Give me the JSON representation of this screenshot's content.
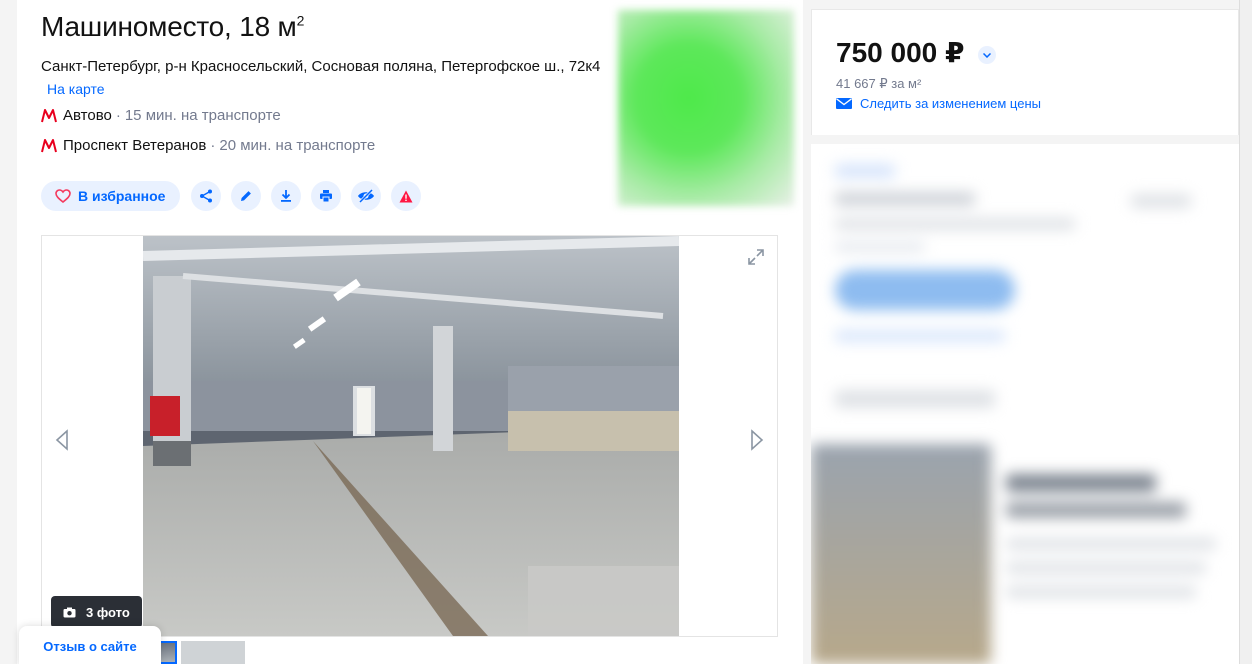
{
  "listing": {
    "title": "Машиноместо, 18 м",
    "title_sup": "2",
    "address_line": "Санкт-Петербург, р-н Красносельский, Сосновая поляна, Петергофское ш., 72к4",
    "map_link": "На карте",
    "metro": [
      {
        "station": "Автово",
        "time": "15 мин. на транспорте"
      },
      {
        "station": "Проспект Ветеранов",
        "time": "20 мин. на транспорте"
      }
    ],
    "metro_separator": "·"
  },
  "actions": {
    "favorite_label": "В избранное",
    "icons": [
      "share-icon",
      "edit-icon",
      "download-icon",
      "print-icon",
      "hide-icon",
      "report-icon"
    ]
  },
  "gallery": {
    "photo_count_label": "3 фото"
  },
  "feedback": {
    "label": "Отзыв о сайте"
  },
  "price_card": {
    "price": "750 000 ₽",
    "price_per_sqm": "41 667 ₽ за м²",
    "watch_price_label": "Следить за изменением цены"
  },
  "colors": {
    "accent": "#0468ff",
    "accent_light": "#e9f1ff",
    "metro_red": "#e8001e",
    "report_red": "#ff1744",
    "favorite_heart": "#f43a5e",
    "muted_text": "#737a8e"
  }
}
